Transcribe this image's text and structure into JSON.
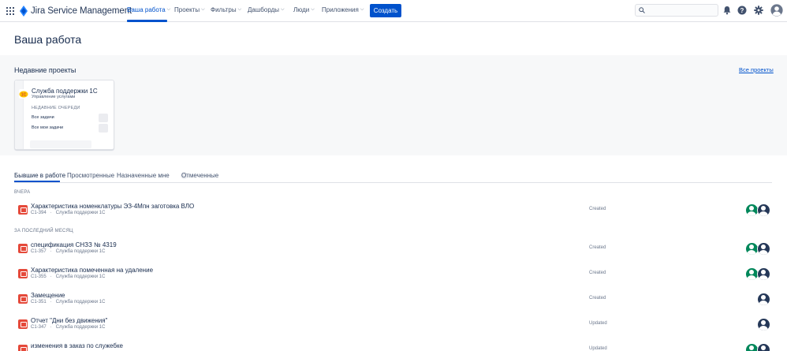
{
  "header": {
    "logo_text": "Jira Service Management",
    "nav": [
      {
        "label": "Ваша работа",
        "active": true
      },
      {
        "label": "Проекты",
        "active": false
      },
      {
        "label": "Фильтры",
        "active": false
      },
      {
        "label": "Дашборды",
        "active": false
      },
      {
        "label": "Люди",
        "active": false
      },
      {
        "label": "Приложения",
        "active": false
      }
    ],
    "create_label": "Создать",
    "search_placeholder": "",
    "icons": [
      "notifications-icon",
      "help-icon",
      "settings-icon",
      "profile-avatar-icon"
    ]
  },
  "page": {
    "title": "Ваша работа"
  },
  "recent": {
    "title": "Недавние проекты",
    "all_link": "Все проекты",
    "card": {
      "name": "Служба поддержки 1С",
      "type": "Управление услугами",
      "queues_heading": "НЕДАВНИЕ ОЧЕРЕДИ",
      "queues": [
        "Все задачи",
        "Все мои задачи"
      ]
    }
  },
  "tabs": [
    {
      "label": "Бывшие в работе",
      "active": true
    },
    {
      "label": "Просмотренные",
      "active": false
    },
    {
      "label": "Назначенные мне",
      "active": false
    },
    {
      "label": "Отмеченные",
      "active": false
    }
  ],
  "sections": {
    "yesterday": "ВЧЕРА",
    "last_month": "ЗА ПОСЛЕДНИЙ МЕСЯЦ"
  },
  "items": [
    {
      "title": "Характеристика номенклатуры ЭЗ-4Мпн заготовка ВЛО",
      "key": "C1-394",
      "project": "Служба поддержки 1С",
      "action": "Created",
      "avatars": [
        "green",
        "dark"
      ]
    },
    {
      "title": "спецификация СНЗЗ № 4319",
      "key": "C1-357",
      "project": "Служба поддержки 1С",
      "action": "Created",
      "avatars": [
        "green",
        "dark"
      ]
    },
    {
      "title": "Характеристика помеченная на удаление",
      "key": "C1-355",
      "project": "Служба поддержки 1С",
      "action": "Created",
      "avatars": [
        "green",
        "dark"
      ]
    },
    {
      "title": "Замещение",
      "key": "C1-351",
      "project": "Служба поддержки 1С",
      "action": "Created",
      "avatars": [
        "dark"
      ]
    },
    {
      "title": "Отчет \"Дни без движения\"",
      "key": "C1-347",
      "project": "Служба поддержки 1С",
      "action": "Updated",
      "avatars": [
        "dark"
      ]
    },
    {
      "title": "изменения в заказ по служебке",
      "key": "",
      "project": "",
      "action": "Updated",
      "avatars": [
        "green",
        "dark"
      ]
    }
  ],
  "colors": {
    "accent": "#0052cc",
    "issue_type": "#e5493a",
    "avatar_green": "#00875a",
    "avatar_dark": "#253858"
  }
}
